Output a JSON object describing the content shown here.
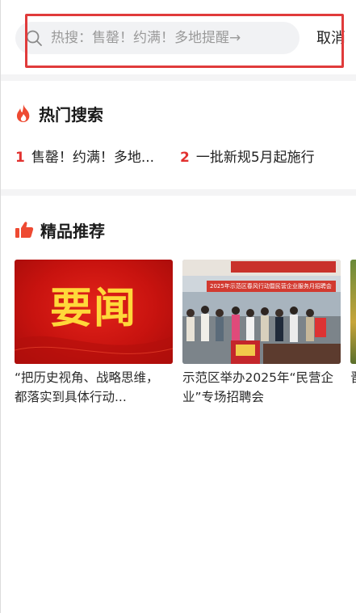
{
  "search": {
    "placeholder": "热搜：售罄！约满！多地提醒→",
    "cancel_label": "取消"
  },
  "hot_search": {
    "title": "热门搜索",
    "items": [
      {
        "rank": "1",
        "text": "售罄！约满！多地..."
      },
      {
        "rank": "2",
        "text": "一批新规5月起施行"
      }
    ]
  },
  "recommend": {
    "title": "精品推荐",
    "cards": [
      {
        "image_caption": "要闻",
        "title": "“把历史视角、战略思维，都落实到具体行动..."
      },
      {
        "banner_text": "2025年示范区春风行动暨民营企业服务月招聘会",
        "title": "示范区举办2025年“民营企业”专场招聘会"
      },
      {
        "title": "晋昌"
      }
    ]
  },
  "colors": {
    "accent_red": "#e2312f",
    "highlight_box": "#e03b3b",
    "search_bg": "#f1f2f4"
  }
}
